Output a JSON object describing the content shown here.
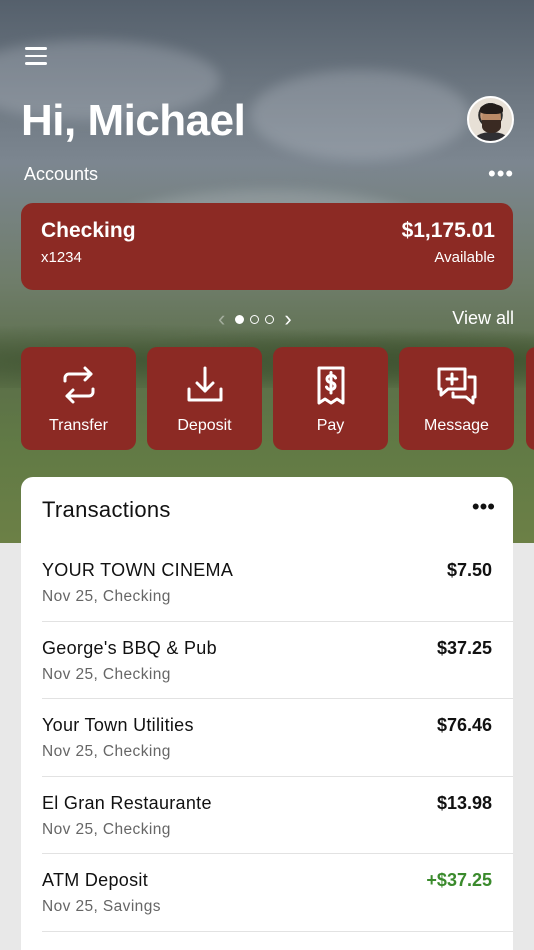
{
  "header": {
    "greeting": "Hi, Michael",
    "accounts_label": "Accounts"
  },
  "account": {
    "name": "Checking",
    "number": "x1234",
    "balance": "$1,175.01",
    "balance_label": "Available"
  },
  "pager": {
    "pages": 3,
    "current": 1,
    "view_all": "View all"
  },
  "actions": [
    {
      "label": "Transfer",
      "icon": "transfer-arrows-icon"
    },
    {
      "label": "Deposit",
      "icon": "download-tray-icon"
    },
    {
      "label": "Pay",
      "icon": "receipt-dollar-icon"
    },
    {
      "label": "Message",
      "icon": "chat-plus-icon"
    }
  ],
  "transactions": {
    "title": "Transactions",
    "items": [
      {
        "name": "YOUR TOWN CINEMA",
        "sub": "Nov 25, Checking",
        "amount": "$7.50",
        "credit": false
      },
      {
        "name": "George's BBQ & Pub",
        "sub": "Nov 25, Checking",
        "amount": "$37.25",
        "credit": false
      },
      {
        "name": "Your Town Utilities",
        "sub": "Nov 25, Checking",
        "amount": "$76.46",
        "credit": false
      },
      {
        "name": "El Gran Restaurante",
        "sub": "Nov 25, Checking",
        "amount": "$13.98",
        "credit": false
      },
      {
        "name": "ATM Deposit",
        "sub": "Nov 25, Savings",
        "amount": "+$37.25",
        "credit": true
      }
    ]
  },
  "colors": {
    "accent": "#8c2a24",
    "credit": "#3a8a2c"
  }
}
